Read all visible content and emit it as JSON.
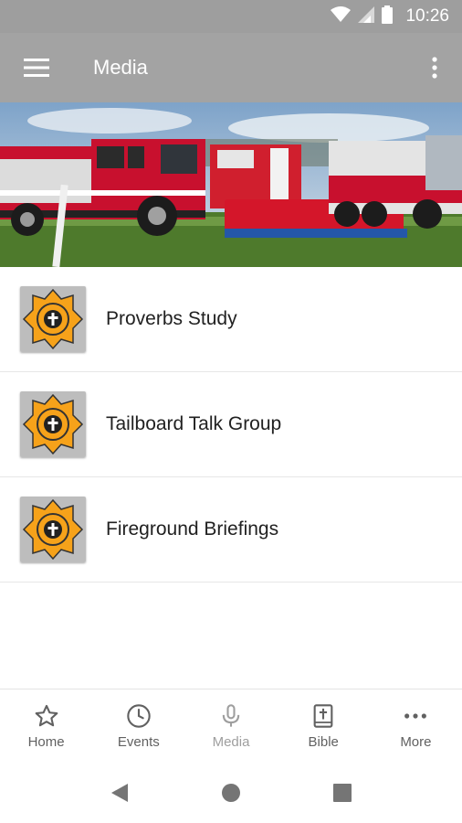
{
  "status_bar": {
    "time": "10:26"
  },
  "app_bar": {
    "title": "Media"
  },
  "media_items": [
    {
      "label": "Proverbs Study"
    },
    {
      "label": "Tailboard Talk Group"
    },
    {
      "label": "Fireground Briefings"
    }
  ],
  "bottom_nav": {
    "items": [
      {
        "label": "Home",
        "icon": "star-icon"
      },
      {
        "label": "Events",
        "icon": "clock-icon"
      },
      {
        "label": "Media",
        "icon": "microphone-icon",
        "active": true
      },
      {
        "label": "Bible",
        "icon": "bible-icon"
      },
      {
        "label": "More",
        "icon": "more-dots-icon"
      }
    ]
  },
  "colors": {
    "app_bar": "#a3a3a3",
    "status_bar": "#9e9e9e",
    "logo_orange": "#f6a21a",
    "active_nav": "#9e9e9e",
    "inactive_nav": "#616161"
  }
}
